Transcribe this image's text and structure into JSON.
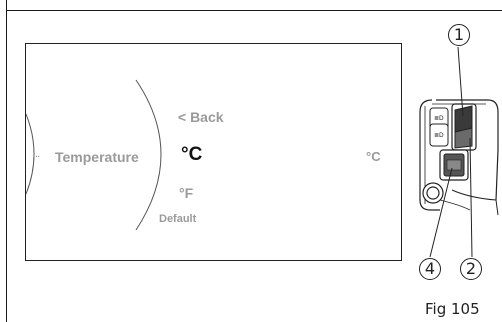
{
  "menu": {
    "prev_item": "...",
    "item": "Temperature",
    "options": {
      "back": "< Back",
      "celsius": "°C",
      "fahrenheit": "°F",
      "default": "Default"
    },
    "current_value": "°C"
  },
  "callouts": {
    "c1": "1",
    "c2": "2",
    "c4": "4"
  },
  "figure_label": "Fig 105"
}
